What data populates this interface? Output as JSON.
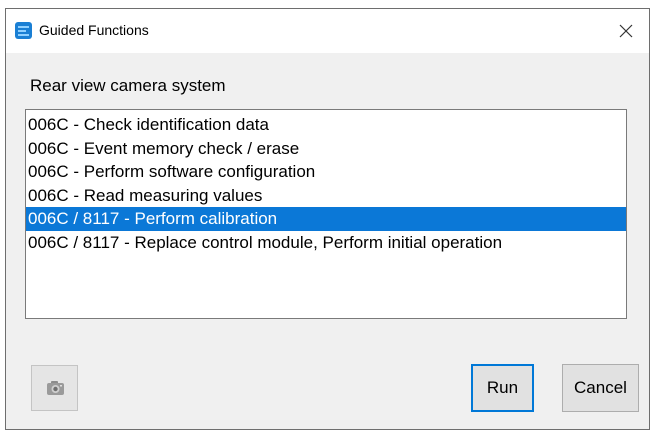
{
  "window": {
    "title": "Guided Functions",
    "close_glyph": "×"
  },
  "heading": "Rear view camera system",
  "list": {
    "items": [
      "006C - Check identification data",
      "006C - Event memory check / erase",
      "006C - Perform software configuration",
      "006C - Read measuring values",
      "006C / 8117 - Perform calibration",
      "006C / 8117 - Replace control module, Perform initial operation"
    ],
    "selected_index": 4
  },
  "buttons": {
    "run_label": "Run",
    "cancel_label": "Cancel"
  },
  "icons": {
    "app": "app-logo-icon",
    "close": "close-icon",
    "camera": "camera-icon"
  },
  "colors": {
    "selection": "#0b78d7",
    "app_icon": "#1a7fd4",
    "default_button_border": "#0078d7"
  }
}
